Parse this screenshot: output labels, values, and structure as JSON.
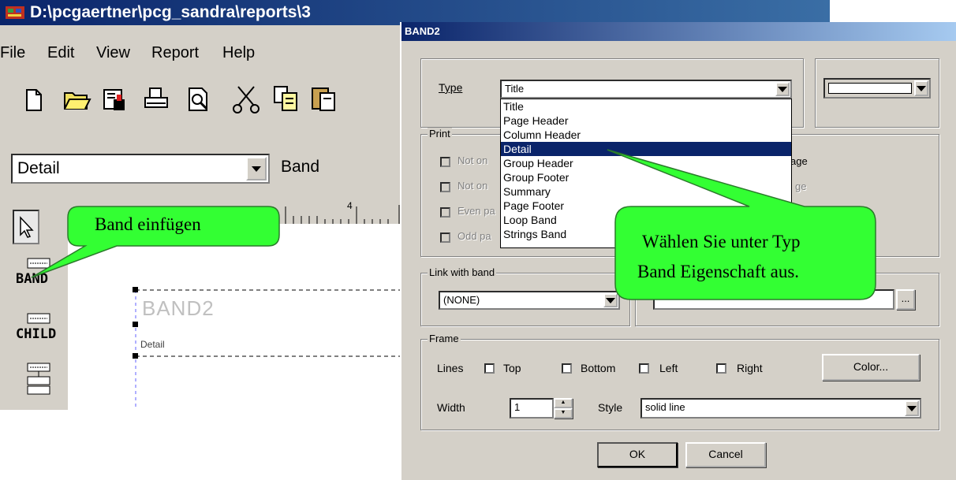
{
  "main_window": {
    "title": "D:\\pcgaertner\\pcg_sandra\\reports\\3",
    "menu": [
      "File",
      "Edit",
      "View",
      "Report",
      "Help"
    ],
    "band_combo_value": "Detail",
    "band_label": "Band",
    "ruler_tick_label": "4",
    "palette": {
      "band_label": "BAND",
      "child_label": "CHILD"
    },
    "canvas": {
      "band_name": "BAND2",
      "band_type": "Detail"
    }
  },
  "dialog": {
    "title": "BAND2",
    "type_label": "Type",
    "type_value": "Title",
    "type_options": [
      "Title",
      "Page Header",
      "Column Header",
      "Detail",
      "Group Header",
      "Group Footer",
      "Summary",
      "Page Footer",
      "Loop Band",
      "Strings Band"
    ],
    "type_highlighted": "Detail",
    "print_group": {
      "legend": "Print",
      "left_options": [
        "Not on",
        "Not on",
        "Even pa",
        "Odd pa"
      ],
      "right_options": [
        "age",
        "ge",
        "umn"
      ]
    },
    "link_group": {
      "legend": "Link with band",
      "value": "(NONE)",
      "browse_label": "..."
    },
    "frame_group": {
      "legend": "Frame",
      "lines_label": "Lines",
      "top_label": "Top",
      "bottom_label": "Bottom",
      "left_label": "Left",
      "right_label": "Right",
      "color_button": "Color...",
      "width_label": "Width",
      "width_value": "1",
      "style_label": "Style",
      "style_value": "solid line"
    },
    "ok_button": "OK",
    "cancel_button": "Cancel"
  },
  "callouts": {
    "insert_band": "Band einfügen",
    "choose_type_line1": "Wählen Sie unter Typ",
    "choose_type_line2": "Band Eigenschaft aus."
  },
  "colors": {
    "callout_fill": "#33ff33",
    "titlebar": "#0a246a",
    "selection": "#0a246a",
    "window_bg": "#d4d0c8"
  }
}
